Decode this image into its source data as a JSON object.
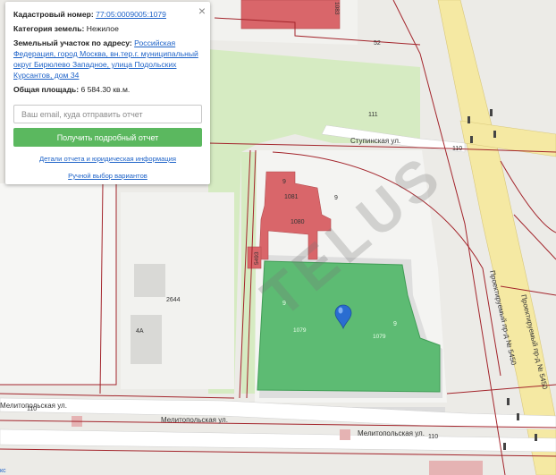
{
  "popup": {
    "cadastral_label": "Кадастровый номер:",
    "cadastral_number": "77:05:0009005:1079",
    "category_label": "Категория земель:",
    "category_value": "Нежилое",
    "address_label": "Земельный участок по адресу:",
    "address_value": "Российская Федерация, город Москва, вн.тер.г. муниципальный округ Бирюлево Западное, улица Подольских Курсантов, дом 34",
    "area_label": "Общая площадь:",
    "area_value": "6 584.30 кв.м.",
    "email_placeholder": "Ваш email, куда отправить отчет",
    "report_button": "Получить подробный отчет",
    "details_link": "Детали отчета и юридическая информация",
    "manual_link": "Ручной выбор вариантов",
    "close_symbol": "×"
  },
  "map": {
    "streets": {
      "stupinskaya": "Ступинская ул.",
      "melitopolskaya_1": "Мелитопольская ул.",
      "melitopolskaya_2": "Мелитопольская ул.",
      "melitopolskaya_3": "Мелитопольская ул.",
      "proektiruemy_1": "Проектируемый пр-д № 5450",
      "proektiruemy_2": "Проектируемый пр-д № 5450"
    },
    "labels": {
      "n52": "52",
      "n111": "111",
      "n110_right": "110",
      "n110_left": "110",
      "n110_bottom": "110",
      "n2644": "2644",
      "n4a": "4А",
      "n1080": "1080",
      "n1079_a": "1079",
      "n1079_b": "1079",
      "n9_a": "9",
      "n9_b": "9",
      "n9_c": "9",
      "n9_d": "9",
      "n1081": "1081",
      "n5493": "5493",
      "n1083": "1083",
      "edge": "кс"
    },
    "watermark": "TELUS",
    "colors": {
      "parcel_green": "#5dbb73",
      "building_red": "#d9666a",
      "park_green": "#d6ebc2",
      "road_yellow": "#f5e9a3",
      "cadastre_line": "#a3242b",
      "marker_blue": "#2a6dd1"
    }
  }
}
